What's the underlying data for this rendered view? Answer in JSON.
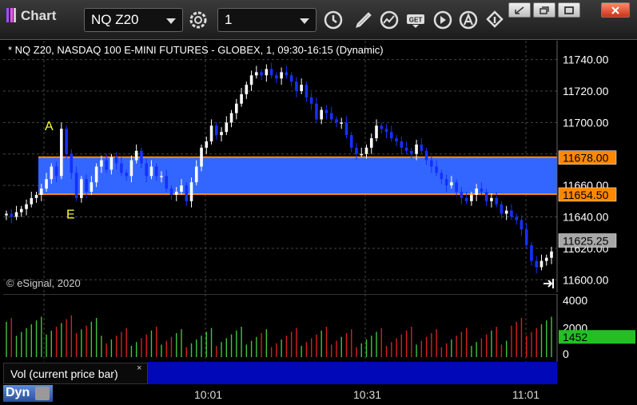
{
  "toolbar": {
    "app_title": "Chart",
    "symbol": "NQ Z20",
    "interval": "1",
    "icons": [
      "settings-gear-icon",
      "clock-icon",
      "pencil-draw-icon",
      "study-icon",
      "get-data-icon",
      "play-icon",
      "alert-icon",
      "link-icon"
    ],
    "window_buttons": [
      "restore-icon",
      "cascade-icon",
      "maximize-icon",
      "close-icon"
    ]
  },
  "chart": {
    "title": "* NQ Z20, NASDAQ 100 E-MINI FUTURES - GLOBEX, 1, 09:30-16:15 (Dynamic)",
    "copyright": "© eSignal, 2020",
    "price_labels": [
      "11740.00",
      "11720.00",
      "11700.00",
      "11680.00",
      "11660.00",
      "11640.00",
      "11620.00",
      "11600.00"
    ],
    "upper_line_label": "11678.00",
    "lower_line_label": "11654.50",
    "last_price_label": "11625.25",
    "marker_a": "A",
    "marker_e": "E",
    "time_labels": [
      "10:01",
      "10:31",
      "11:01"
    ],
    "volume_labels": [
      "4000",
      "2000",
      "0"
    ],
    "last_volume_label": "1452",
    "volume_study": "Vol (current price bar)",
    "close_glyph": "×",
    "mode": "Dyn",
    "colors": {
      "up": "#ffffff",
      "down": "#1530ff",
      "band": "#3366ff",
      "band_lines": "#ff8800",
      "vol_up": "#3ec43e",
      "vol_down": "#d42020",
      "last_volume_bg": "#23c023",
      "last_price_bg": "#a8a8a8"
    }
  },
  "chart_data": {
    "type": "candlestick",
    "title": "NQ Z20, NASDAQ 100 E-MINI FUTURES - GLOBEX, 1, 09:30-16:15 (Dynamic)",
    "ylim": [
      11592,
      11752
    ],
    "y_ticks": [
      11600,
      11620,
      11640,
      11660,
      11680,
      11700,
      11720,
      11740
    ],
    "x_ticks": [
      "10:01",
      "10:31",
      "11:01"
    ],
    "horizontal_lines": [
      11678.0,
      11654.5
    ],
    "last_price": 11625.25,
    "close_series": [
      11642,
      11640,
      11643,
      11645,
      11648,
      11652,
      11654,
      11658,
      11664,
      11672,
      11666,
      11696,
      11680,
      11668,
      11652,
      11664,
      11656,
      11662,
      11672,
      11676,
      11670,
      11678,
      11674,
      11668,
      11666,
      11676,
      11682,
      11674,
      11666,
      11672,
      11666,
      11666,
      11658,
      11654,
      11656,
      11660,
      11650,
      11662,
      11672,
      11684,
      11688,
      11698,
      11692,
      11694,
      11700,
      11706,
      11712,
      11718,
      11724,
      11730,
      11732,
      11730,
      11734,
      11730,
      11728,
      11732,
      11730,
      11726,
      11720,
      11724,
      11716,
      11712,
      11702,
      11708,
      11706,
      11702,
      11700,
      11700,
      11692,
      11684,
      11680,
      11680,
      11684,
      11690,
      11698,
      11696,
      11694,
      11690,
      11688,
      11684,
      11682,
      11680,
      11686,
      11682,
      11676,
      11672,
      11668,
      11664,
      11660,
      11662,
      11656,
      11652,
      11650,
      11654,
      11658,
      11656,
      11650,
      11652,
      11648,
      11642,
      11644,
      11640,
      11638,
      11632,
      11622,
      11612,
      11608,
      11612,
      11614,
      11618
    ],
    "volume_range": [
      0,
      4000
    ],
    "last_volume": 1452
  }
}
